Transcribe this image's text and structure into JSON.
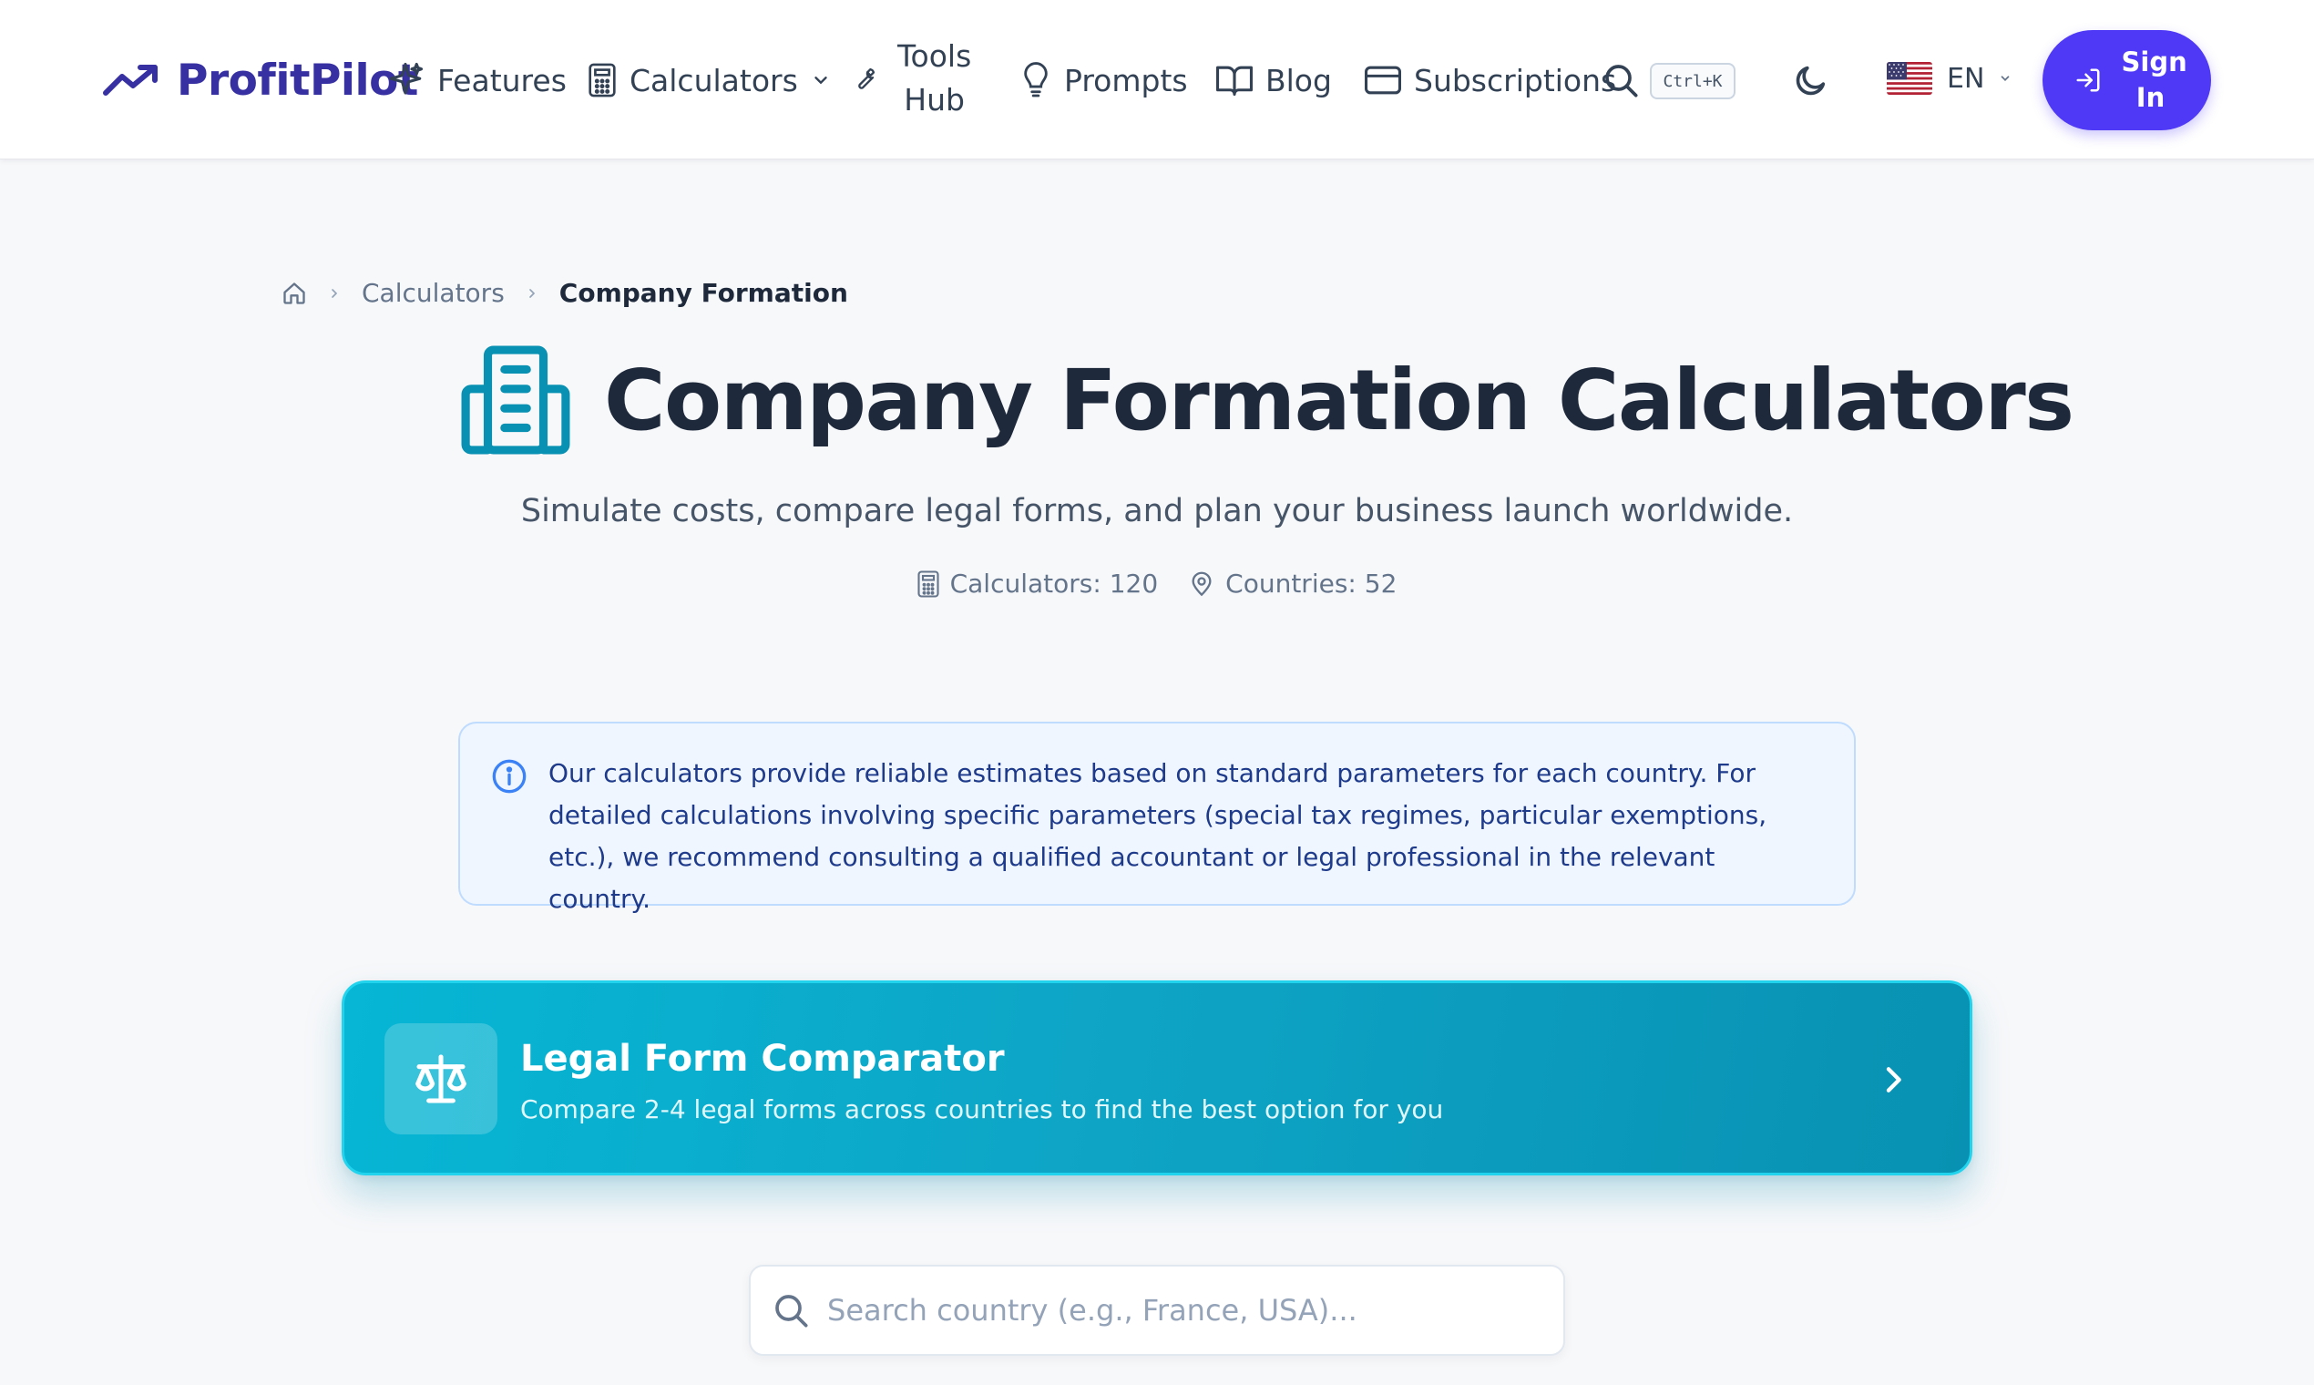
{
  "header": {
    "brand": "ProfitPilot",
    "nav": {
      "features": "Features",
      "calculators": "Calculators",
      "tools_line1": "Tools",
      "tools_line2": "Hub",
      "prompts": "Prompts",
      "blog": "Blog",
      "subscriptions": "Subscriptions"
    },
    "search_shortcut": "Ctrl+K",
    "language": "EN",
    "signin_line1": "Sign",
    "signin_line2": "In"
  },
  "breadcrumb": {
    "level1": "Calculators",
    "current": "Company Formation"
  },
  "page": {
    "title": "Company Formation Calculators",
    "subtitle": "Simulate costs, compare legal forms, and plan your business launch worldwide.",
    "stats": {
      "calculators": "Calculators: 120",
      "countries": "Countries: 52"
    }
  },
  "notice": {
    "text": "Our calculators provide reliable estimates based on standard parameters for each country. For detailed calculations involving specific parameters (special tax regimes, particular exemptions, etc.), we recommend consulting a qualified accountant or legal professional in the relevant country."
  },
  "feature_card": {
    "title": "Legal Form Comparator",
    "description": "Compare 2-4 legal forms across countries to find the best option for you"
  },
  "country_search": {
    "placeholder": "Search country (e.g., France, USA)..."
  },
  "colors": {
    "brand": "#3730a3",
    "primary_button": "#4f39f6",
    "accent_teal": "#0891b2",
    "info_blue": "#3b82f6"
  }
}
